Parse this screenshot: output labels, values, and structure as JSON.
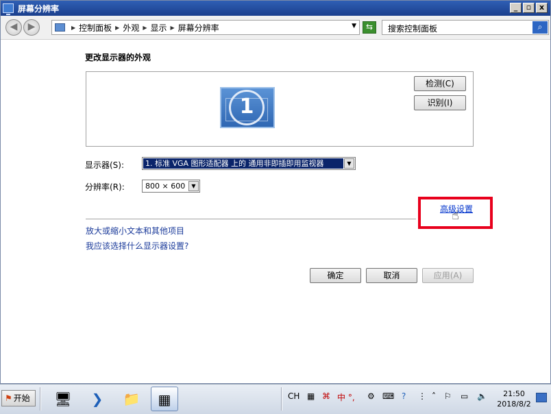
{
  "window": {
    "title": "屏幕分辨率",
    "controls": {
      "minimize": "_",
      "restore": "▫",
      "close": "x"
    }
  },
  "addressbar": {
    "breadcrumb": [
      "控制面板",
      "外观",
      "显示",
      "屏幕分辨率"
    ],
    "search_placeholder": "搜索控制面板"
  },
  "content": {
    "heading": "更改显示器的外观",
    "monitor_number": "1",
    "detect_button": "检测(C)",
    "identify_button": "识别(I)",
    "display_label": "显示器(S):",
    "display_value": "1. 标准 VGA 图形适配器 上的 通用非即插即用监视器",
    "resolution_label": "分辨率(R):",
    "resolution_value": "800 × 600",
    "advanced_link": "高级设置",
    "link_text_size": "放大或缩小文本和其他项目",
    "link_which_settings": "我应该选择什么显示器设置?",
    "ok_button": "确定",
    "cancel_button": "取消",
    "apply_button": "应用(A)"
  },
  "taskbar": {
    "start_label": "开始",
    "input_lang": "CH",
    "ime_text": "中 °,",
    "clock_time": "21:50",
    "clock_date": "2018/8/2"
  },
  "colors": {
    "highlight": "#e8001c",
    "link": "#1a3a9a",
    "titlebar": "#1b3f8d"
  }
}
